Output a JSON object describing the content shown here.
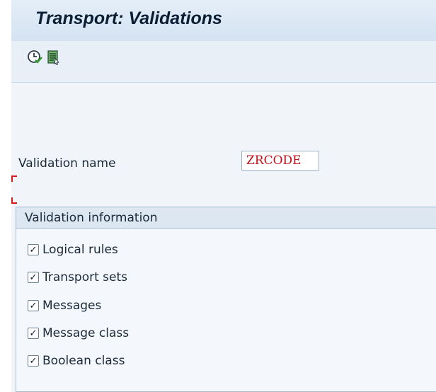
{
  "window": {
    "title": "Transport: Validations"
  },
  "toolbar": {
    "buttons": [
      {
        "icon": "execute-clock-icon"
      },
      {
        "icon": "list-document-icon"
      }
    ]
  },
  "form": {
    "validation_name_label": "Validation name",
    "validation_name_value": "ZRCODE"
  },
  "group": {
    "title": "Validation information",
    "items": [
      {
        "label": "Logical rules",
        "checked": true
      },
      {
        "label": "Transport sets",
        "checked": true
      },
      {
        "label": "Messages",
        "checked": true
      },
      {
        "label": "Message class",
        "checked": true
      },
      {
        "label": "Boolean class",
        "checked": true
      }
    ]
  },
  "colors": {
    "value_text": "#c0131b",
    "focus_marker": "#d91a1a",
    "panel_bg": "#eef3f9"
  },
  "checkmark_glyph": "✓"
}
